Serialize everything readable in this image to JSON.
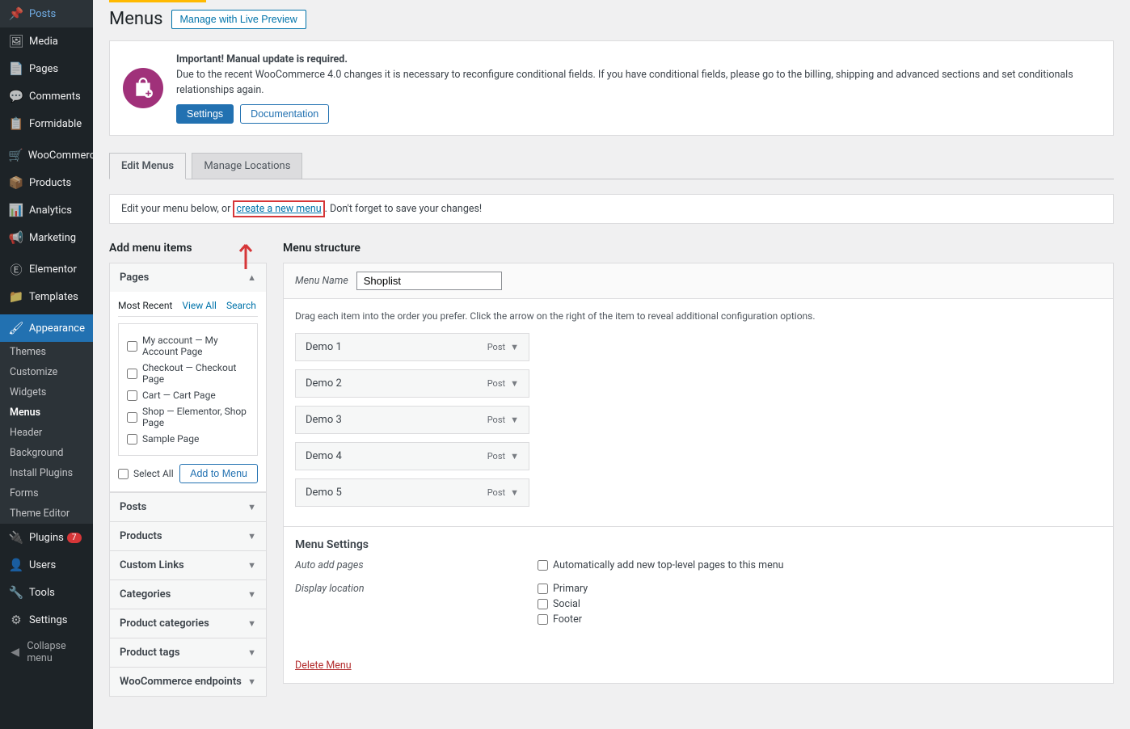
{
  "sidebar": {
    "items": [
      {
        "icon": "pin",
        "label": "Posts"
      },
      {
        "icon": "media",
        "label": "Media"
      },
      {
        "icon": "page",
        "label": "Pages"
      },
      {
        "icon": "comment",
        "label": "Comments"
      },
      {
        "icon": "form",
        "label": "Formidable"
      },
      {
        "icon": "woo",
        "label": "WooCommerce"
      },
      {
        "icon": "product",
        "label": "Products"
      },
      {
        "icon": "analytics",
        "label": "Analytics"
      },
      {
        "icon": "marketing",
        "label": "Marketing"
      },
      {
        "icon": "elementor",
        "label": "Elementor"
      },
      {
        "icon": "templates",
        "label": "Templates"
      },
      {
        "icon": "appearance",
        "label": "Appearance",
        "current": true
      },
      {
        "icon": "plugins",
        "label": "Plugins",
        "badge": "7"
      },
      {
        "icon": "users",
        "label": "Users"
      },
      {
        "icon": "tools",
        "label": "Tools"
      },
      {
        "icon": "settings",
        "label": "Settings"
      }
    ],
    "submenu": [
      "Themes",
      "Customize",
      "Widgets",
      "Menus",
      "Header",
      "Background",
      "Install Plugins",
      "Forms",
      "Theme Editor"
    ],
    "current_sub": "Menus",
    "collapse": "Collapse menu"
  },
  "page": {
    "title": "Menus",
    "live_preview": "Manage with Live Preview"
  },
  "notice": {
    "strong": "Important! Manual update is required.",
    "text": "Due to the recent WooCommerce 4.0 changes it is necessary to reconfigure conditional fields. If you have conditional fields, please go to the billing, shipping and advanced sections and set conditionals relationships again.",
    "settings": "Settings",
    "docs": "Documentation"
  },
  "tabs": {
    "edit": "Edit Menus",
    "manage": "Manage Locations"
  },
  "info": {
    "before": "Edit your menu below, or ",
    "link": "create a new menu",
    "after": ". Don't forget to save your changes!"
  },
  "left": {
    "title": "Add menu items",
    "pages": "Pages",
    "mini_tabs": [
      "Most Recent",
      "View All",
      "Search"
    ],
    "page_items": [
      "My account — My Account Page",
      "Checkout — Checkout Page",
      "Cart — Cart Page",
      "Shop — Elementor, Shop Page",
      "Sample Page"
    ],
    "select_all": "Select All",
    "add_to_menu": "Add to Menu",
    "panels": [
      "Posts",
      "Products",
      "Custom Links",
      "Categories",
      "Product categories",
      "Product tags",
      "WooCommerce endpoints"
    ]
  },
  "right": {
    "title": "Menu structure",
    "name_label": "Menu Name",
    "name_value": "Shoplist",
    "hint": "Drag each item into the order you prefer. Click the arrow on the right of the item to reveal additional configuration options.",
    "items": [
      {
        "label": "Demo 1",
        "type": "Post"
      },
      {
        "label": "Demo 2",
        "type": "Post"
      },
      {
        "label": "Demo 3",
        "type": "Post"
      },
      {
        "label": "Demo 4",
        "type": "Post"
      },
      {
        "label": "Demo 5",
        "type": "Post"
      }
    ],
    "settings_title": "Menu Settings",
    "auto_add_label": "Auto add pages",
    "auto_add_opt": "Automatically add new top-level pages to this menu",
    "display_label": "Display location",
    "locations": [
      "Primary",
      "Social",
      "Footer"
    ],
    "delete": "Delete Menu"
  }
}
